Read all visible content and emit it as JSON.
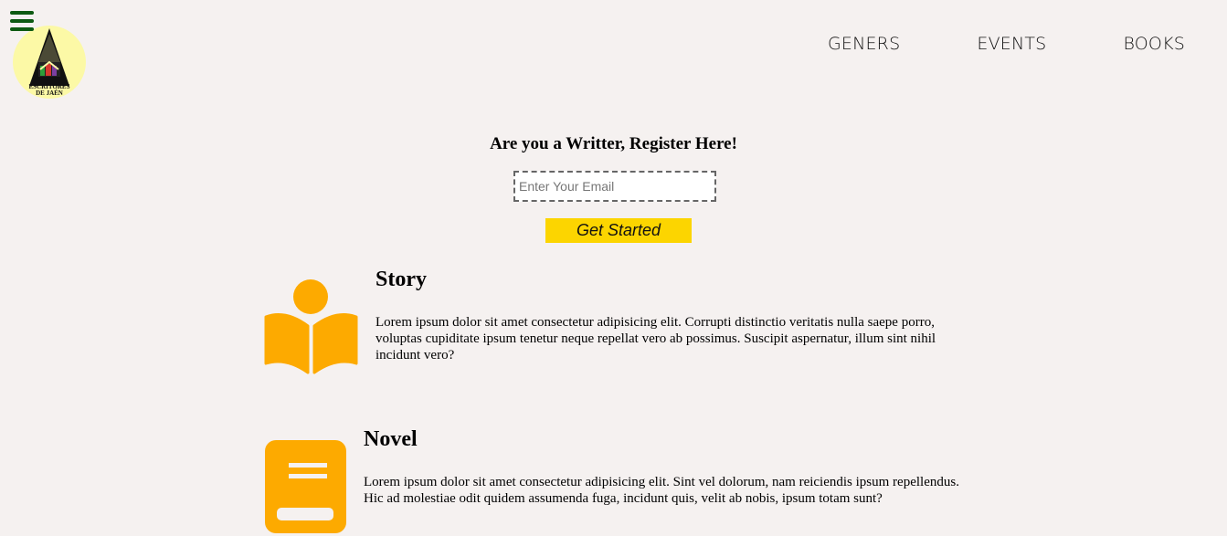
{
  "header": {
    "menu_icon": "hamburger-menu-icon",
    "logo": {
      "text_line1": "ESCRITORES",
      "text_line2": "DE JAÉN"
    },
    "nav": [
      {
        "label": "GENERS"
      },
      {
        "label": "EVENTS"
      },
      {
        "label": "BOOKS"
      }
    ]
  },
  "register": {
    "heading": "Are you a Writter, Register Here!",
    "email_placeholder": "Enter Your Email",
    "email_value": "",
    "button_label": "Get Started",
    "button_color": "#fcd500"
  },
  "features": [
    {
      "icon": "reader-book-icon",
      "title": "Story",
      "text": "Lorem ipsum dolor sit amet consectetur adipisicing elit. Corrupti distinctio veritatis nulla saepe porro, voluptas cupiditate ipsum tenetur neque repellat vero ab possimus. Suscipit aspernatur, illum sint nihil incidunt vero?"
    },
    {
      "icon": "book-icon",
      "title": "Novel",
      "text": "Lorem ipsum dolor sit amet consectetur adipisicing elit. Sint vel dolorum, nam reiciendis ipsum repellendus. Hic ad molestiae odit quidem assumenda fuga, incidunt quis, velit ab nobis, ipsum totam sunt?"
    }
  ],
  "colors": {
    "background": "#f5f1f0",
    "accent_icon": "#fdaa00",
    "menu_icon": "#0d5a12",
    "logo_bg": "#fcf9a6"
  }
}
